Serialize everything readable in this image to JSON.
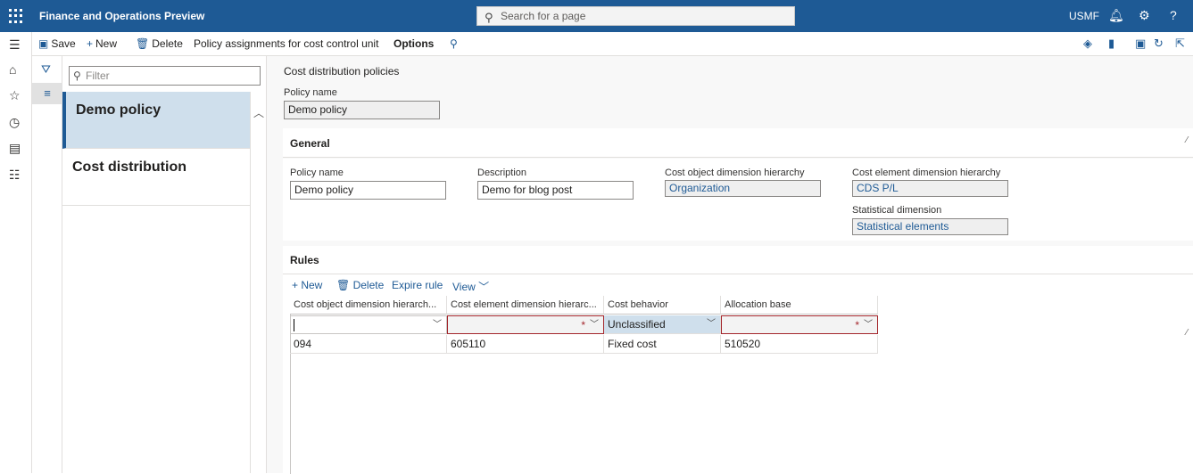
{
  "topbar": {
    "app_title": "Finance and Operations Preview",
    "search_placeholder": "Search for a page",
    "company": "USMF"
  },
  "actions": {
    "save": "Save",
    "new": "New",
    "delete": "Delete",
    "policy_assignments": "Policy assignments for cost control unit",
    "options": "Options"
  },
  "list": {
    "filter_placeholder": "Filter",
    "items": [
      "Demo policy",
      "Cost distribution"
    ]
  },
  "header": {
    "caption": "Cost distribution policies",
    "policy_name_label": "Policy name",
    "policy_name_value": "Demo policy"
  },
  "general": {
    "title": "General",
    "policy_name_label": "Policy name",
    "policy_name_value": "Demo policy",
    "description_label": "Description",
    "description_value": "Demo for blog post",
    "cost_object_label": "Cost object dimension hierarchy",
    "cost_object_value": "Organization",
    "cost_element_label": "Cost element dimension hierarchy",
    "cost_element_value": "CDS P/L",
    "statistical_label": "Statistical dimension",
    "statistical_value": "Statistical elements"
  },
  "rules": {
    "title": "Rules",
    "new": "New",
    "delete": "Delete",
    "expire": "Expire rule",
    "view": "View",
    "columns": [
      "Cost object dimension hierarch...",
      "Cost element dimension hierarc...",
      "Cost behavior",
      "Allocation base"
    ],
    "edit_row": [
      "",
      "",
      "Unclassified",
      ""
    ],
    "rows": [
      [
        "094",
        "605110",
        "Fixed cost",
        "510520"
      ]
    ]
  }
}
